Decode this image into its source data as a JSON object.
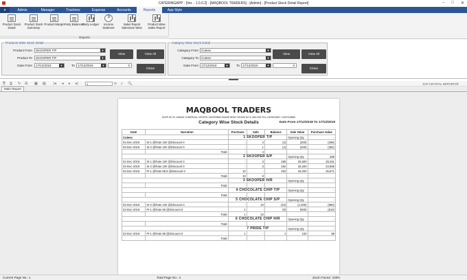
{
  "window": {
    "title": "CATERINGAPP - [Ver. : 1.0.0.2] - [MAQBOOL TRADERS] - [Admin] - [Product Stock Detail Report]",
    "min": "–",
    "max": "□",
    "close": "✕"
  },
  "menu": {
    "file": "▾",
    "items": [
      "Admin",
      "Manager",
      "Tractions",
      "Expense",
      "Accounts",
      "Reports",
      "App Style"
    ],
    "active": "Reports"
  },
  "ribbon": {
    "buttons": [
      "Product Stock Detail",
      "Product Stock Summary",
      "Product Margin",
      "Party Balances",
      "Party Ledger",
      "Income Statment",
      "Sales Report Salesman Wise",
      "Product Wise Sales Report"
    ],
    "group_label": "Reports"
  },
  "products_filter": {
    "legend": "Products Wise Stock Detail",
    "product_from_label": "Product From",
    "product_from": "SKOOPER T/P",
    "product_to_label": "Product To",
    "product_to": "SKOOPER T/P",
    "date_from_label": "Date From",
    "date_from": "17/12/2018",
    "to_label": "To",
    "date_to": "17/12/2019",
    "num": "0",
    "view": "View",
    "view_all": "View All",
    "close": "Close"
  },
  "category_filter": {
    "legend": "Category Wise Stock Detail",
    "category_from_label": "Category From",
    "category_from": "Cuteex",
    "category_to_label": "Category To",
    "category_to": "Cuteex",
    "date_from_label": "Date From",
    "date_from": "17/12/2018",
    "to_label": "To",
    "date_to": "17/12/2019",
    "num": "0",
    "view": "View",
    "view_all": "View All",
    "close": "Close"
  },
  "toolbar": {
    "page": "1",
    "of": "/4",
    "zoom_icon": "🔍",
    "brand": "SAP CRYSTAL REPORTS®"
  },
  "tab": "Main Report",
  "report": {
    "company": "MAQBOOL TRADERS",
    "address": "SHOP NO 20, AHMAD COMERCIAL CENTER, HAZORIBAG BAZAR NEAR CHUNGI NO 6, MULTAN TELL:03078220827, 03047028848",
    "subtitle": "Category Wise Stock Details",
    "date_range": "Date From 17/12/2018 To 17/12/2019",
    "headers": [
      "Date",
      "Narration",
      "Purchase",
      "Sale",
      "Balance",
      "Sale Value",
      "Purchase Value"
    ],
    "category": "Cuteex",
    "opening": "Opening Qty",
    "total": "Total:",
    "sections": [
      {
        "name": "1  SKOOPER T/P",
        "opening_val": "-",
        "rows": [
          [
            "01-Dec-2019",
            "SI-1 @Rate 100 @Discount 0",
            "-",
            "3",
            "(3)",
            "(300)",
            "(288)"
          ],
          [
            "02-Dec-2019",
            "SI-2 @Rate 100 @Discount 0",
            "-",
            "1",
            "(4)",
            "(400)",
            "(384)"
          ]
        ],
        "total_p": "-",
        "total_s": "4"
      },
      {
        "name": "2  SKOOPER S/P",
        "opening_val": "288",
        "rows": [
          [
            "01-Dec-2019",
            "SI-1 @Rate 100 @Discount 0",
            "-",
            "3",
            "285",
            "28,500",
            "28,251"
          ],
          [
            "02-Dec-2019",
            "SI-2 @Rate 100 @Discount 0",
            "-",
            "3",
            "282",
            "28,200",
            "24,985"
          ],
          [
            "02-Dec-2019",
            "PI-1 @Rate 88.8 @Discount 0",
            "10",
            "-",
            "292",
            "29,200",
            "25,871"
          ]
        ],
        "total_p": "10",
        "total_s": "6"
      },
      {
        "name": "3  SKOOPER H/R",
        "opening_val": "-",
        "rows": [],
        "total_p": "",
        "total_s": ""
      },
      {
        "name": "4  CHOCOLATE CHIP T/P",
        "opening_val": "-",
        "rows": [],
        "total_p": "",
        "total_s": ""
      },
      {
        "name": "5  CHOCOLATE CHIP S/P",
        "opening_val": "-",
        "rows": [
          [
            "02-Dec-2019",
            "SI-2 @Rate 100 @Discount 0",
            "-",
            "10",
            "(10)",
            "(1,000)",
            "(880)"
          ],
          [
            "02-Dec-2019",
            "PI-1 @Rate 88 @Discount 0",
            "1",
            "-",
            "(9)",
            "(900)",
            "(810)"
          ]
        ],
        "total_p": "1",
        "total_s": "10"
      },
      {
        "name": "6  CHOCOLATE CHIP H/R",
        "opening_val": "-",
        "rows": [],
        "total_p": "",
        "total_s": ""
      },
      {
        "name": "7  PRIDE T/P",
        "opening_val": "-",
        "rows": [
          [
            "02-Dec-2019",
            "PI-1 @Rate 88 @Discount 0",
            "1",
            "-",
            "1",
            "100",
            "88"
          ]
        ],
        "total_p": "",
        "total_s": ""
      }
    ]
  },
  "status": {
    "current": "Current Page No.: 1",
    "total": "Total Page No.: 4",
    "zoom": "Zoom Factor: 100%"
  }
}
